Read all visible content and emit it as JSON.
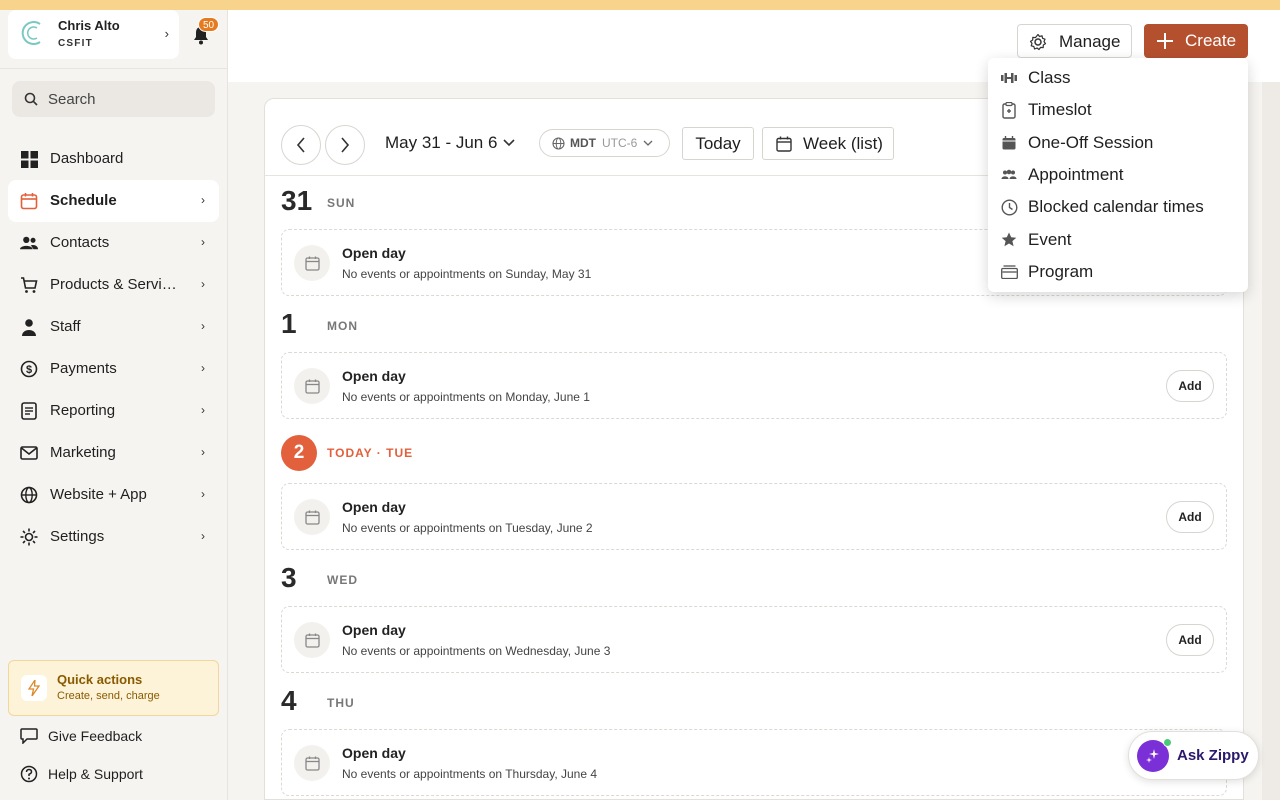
{
  "org": {
    "name": "Chris Alto",
    "subtitle": "CSFIT",
    "notification_count": "50"
  },
  "search": {
    "placeholder": "Search"
  },
  "sidebar": {
    "items": [
      {
        "label": "Dashboard",
        "icon": "dashboard-icon"
      },
      {
        "label": "Schedule",
        "icon": "calendar-icon"
      },
      {
        "label": "Contacts",
        "icon": "contacts-icon"
      },
      {
        "label": "Products & Services",
        "icon": "cart-icon"
      },
      {
        "label": "Staff",
        "icon": "person-icon"
      },
      {
        "label": "Payments",
        "icon": "dollar-icon"
      },
      {
        "label": "Reporting",
        "icon": "report-icon"
      },
      {
        "label": "Marketing",
        "icon": "mail-icon"
      },
      {
        "label": "Website + App",
        "icon": "globe-icon"
      },
      {
        "label": "Settings",
        "icon": "gear-icon"
      }
    ],
    "active": "Schedule",
    "quick_actions": {
      "title": "Quick actions",
      "subtitle": "Create, send, charge"
    },
    "footer": {
      "feedback": "Give Feedback",
      "help": "Help & Support"
    }
  },
  "header": {
    "manage_label": "Manage",
    "create_label": "Create"
  },
  "create_menu": {
    "items": [
      {
        "label": "Class",
        "icon": "dumbbell-icon"
      },
      {
        "label": "Timeslot",
        "icon": "clipboard-icon"
      },
      {
        "label": "One-Off Session",
        "icon": "calendar-filled-icon"
      },
      {
        "label": "Appointment",
        "icon": "group-icon"
      },
      {
        "label": "Blocked calendar times",
        "icon": "clock-icon"
      },
      {
        "label": "Event",
        "icon": "star-icon"
      },
      {
        "label": "Program",
        "icon": "folder-icon"
      }
    ]
  },
  "toolbar": {
    "range": "May 31 - Jun 6",
    "timezone": "MDT",
    "offset": "UTC-6",
    "today_label": "Today",
    "view_label": "Week (list)"
  },
  "days": [
    {
      "num": "31",
      "label": "SUN",
      "title": "Open day",
      "sub": "No events or appointments on Sunday, May 31",
      "today": false
    },
    {
      "num": "1",
      "label": "MON",
      "title": "Open day",
      "sub": "No events or appointments on Monday, June 1",
      "today": false
    },
    {
      "num": "2",
      "label": "TODAY · TUE",
      "title": "Open day",
      "sub": "No events or appointments on Tuesday, June 2",
      "today": true
    },
    {
      "num": "3",
      "label": "WED",
      "title": "Open day",
      "sub": "No events or appointments on Wednesday, June 3",
      "today": false
    },
    {
      "num": "4",
      "label": "THU",
      "title": "Open day",
      "sub": "No events or appointments on Thursday, June 4",
      "today": false
    }
  ],
  "add_label": "Add",
  "zippy": {
    "label": "Ask Zippy"
  },
  "colors": {
    "accent": "#b5502f",
    "today": "#e2603c",
    "banner": "#f7d38c",
    "zippy": "#7b2fd6"
  }
}
